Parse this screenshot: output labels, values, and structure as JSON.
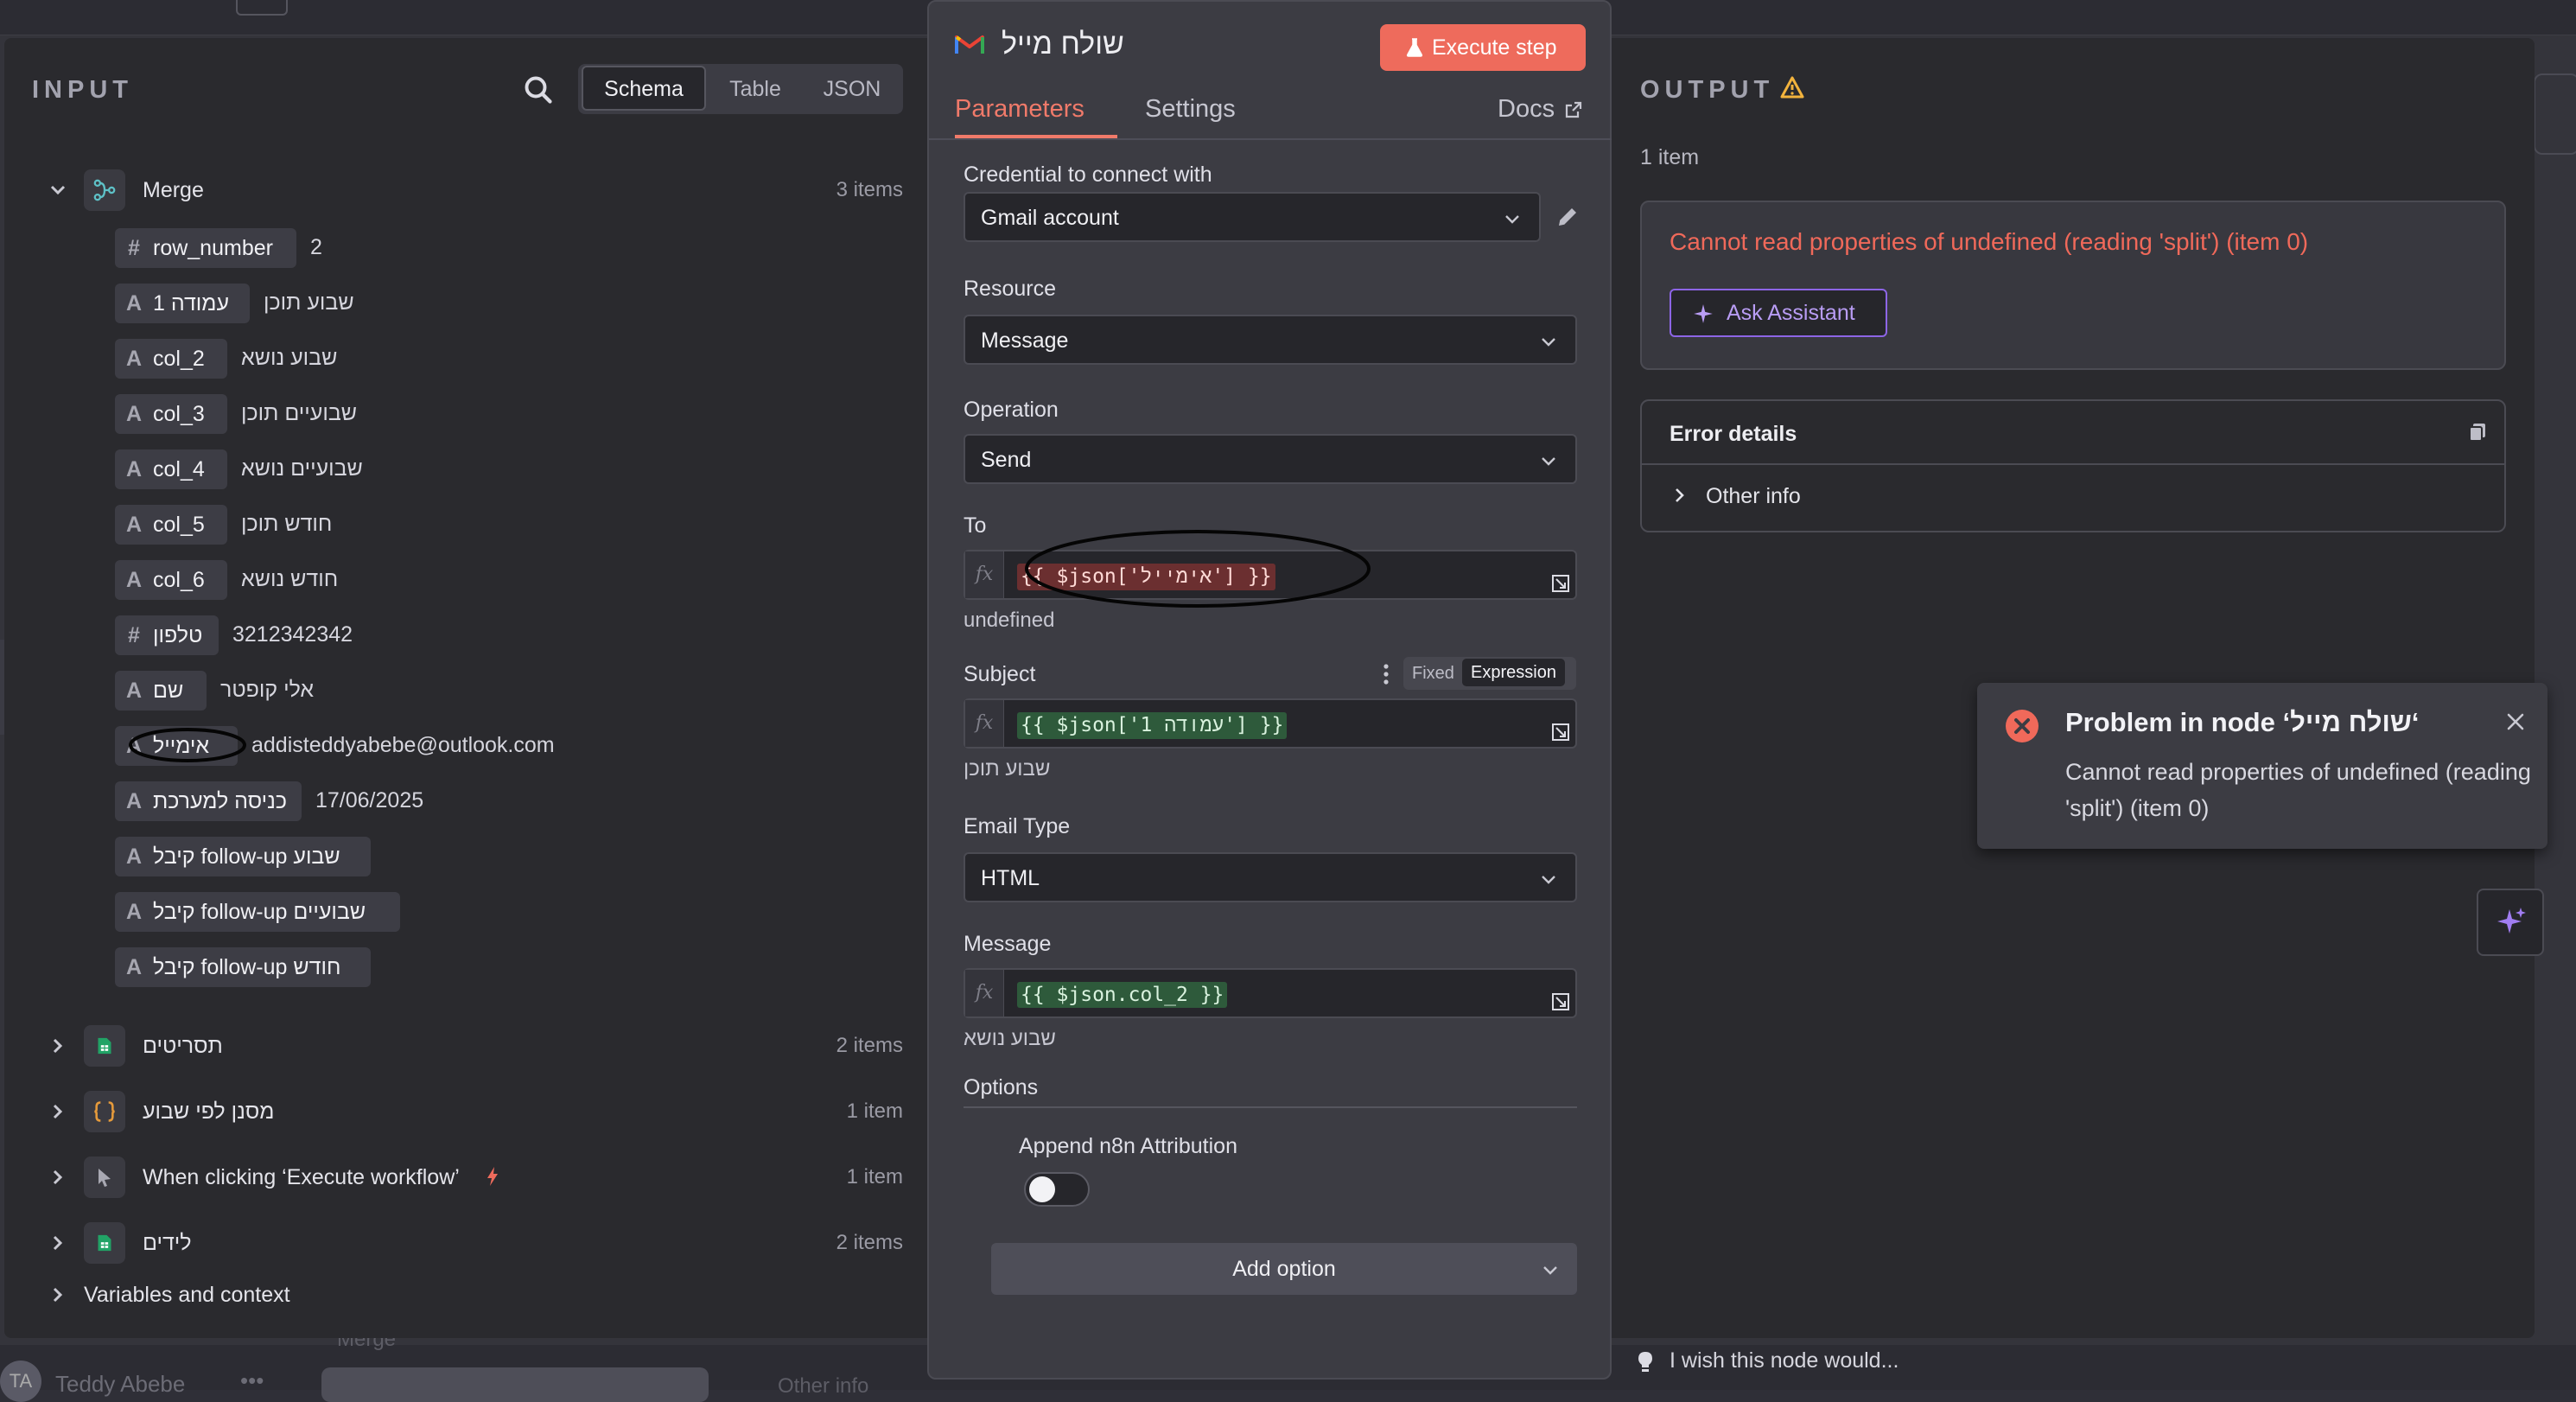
{
  "canvas": {
    "user_initials": "TA",
    "user_name": "Teddy Abebe",
    "user_menu": "•••",
    "bg_node_label": "Merge",
    "bg_other_info": "Other info"
  },
  "input": {
    "title": "INPUT",
    "view_options": [
      "Schema",
      "Table",
      "JSON"
    ],
    "active_view": "Schema",
    "merge": {
      "label": "Merge",
      "count": "3 items",
      "fields": [
        {
          "type": "#",
          "name": "row_number",
          "value": "2"
        },
        {
          "type": "A",
          "name": "עמודה 1",
          "value": "שבוע תוכן"
        },
        {
          "type": "A",
          "name": "col_2",
          "value": "שבוע נושא"
        },
        {
          "type": "A",
          "name": "col_3",
          "value": "שבועיים תוכן"
        },
        {
          "type": "A",
          "name": "col_4",
          "value": "שבועיים נושא"
        },
        {
          "type": "A",
          "name": "col_5",
          "value": "חודש תוכן"
        },
        {
          "type": "A",
          "name": "col_6",
          "value": "חודש נושא"
        },
        {
          "type": "#",
          "name": "טלפון",
          "value": "3212342342"
        },
        {
          "type": "A",
          "name": "שם",
          "value": "אלי קופטר"
        },
        {
          "type": "A",
          "name": "אימייל",
          "value": "addisteddyabebe@outlook.com"
        },
        {
          "type": "A",
          "name": "כניסה למערכת",
          "value": "17/06/2025"
        },
        {
          "type": "A",
          "name": "קיבל follow-up שבוע",
          "value": ""
        },
        {
          "type": "A",
          "name": "קיבל follow-up שבועיים",
          "value": ""
        },
        {
          "type": "A",
          "name": "קיבל follow-up חודש",
          "value": ""
        }
      ]
    },
    "other_nodes": [
      {
        "label": "תסריטים",
        "count": "2 items",
        "icon": "sheets-icon"
      },
      {
        "label": "מסנן לפי שבוע",
        "count": "1 item",
        "icon": "code-braces-icon"
      },
      {
        "label": "When clicking ‘Execute workflow’",
        "count": "1 item",
        "icon": "pointer-icon"
      },
      {
        "label": "לידים",
        "count": "2 items",
        "icon": "sheets-icon"
      }
    ],
    "variables_label": "Variables and context"
  },
  "node": {
    "title": "שולח מייל",
    "execute_label": "Execute step",
    "tabs": {
      "parameters": "Parameters",
      "settings": "Settings",
      "docs": "Docs"
    },
    "credential": {
      "label": "Credential to connect with",
      "value": "Gmail account"
    },
    "resource": {
      "label": "Resource",
      "value": "Message"
    },
    "operation": {
      "label": "Operation",
      "value": "Send"
    },
    "to": {
      "label": "To",
      "expression": "{{ $json['אימייל'] }}",
      "preview": "undefined"
    },
    "subject": {
      "label": "Subject",
      "mode_fixed": "Fixed",
      "mode_expression": "Expression",
      "expression": "{{ $json['עמודה 1'] }}",
      "preview": "שבוע תוכן"
    },
    "email_type": {
      "label": "Email Type",
      "value": "HTML"
    },
    "message": {
      "label": "Message",
      "expression": "{{ $json.col_2 }}",
      "preview": "שבוע נושא"
    },
    "options": {
      "label": "Options",
      "attribution_label": "Append n8n Attribution",
      "attribution_enabled": false,
      "add_option_label": "Add option"
    }
  },
  "output": {
    "title": "OUTPUT",
    "count": "1 item",
    "error_message": "Cannot read properties of undefined (reading 'split') (item 0)",
    "ask_assistant_label": "Ask Assistant",
    "error_details_title": "Error details",
    "other_info_label": "Other info"
  },
  "toast": {
    "title": "Problem in node ‘שולח מייל‘",
    "body": "Cannot read properties of undefined (reading 'split') (item 0)"
  },
  "feedback": "I wish this node would...",
  "colors": {
    "accent": "#f07a6a",
    "error": "#f0695a",
    "assistant": "#8d65e6",
    "expression_ok": "#2e5a3b",
    "expression_bad": "#6b2f30"
  }
}
